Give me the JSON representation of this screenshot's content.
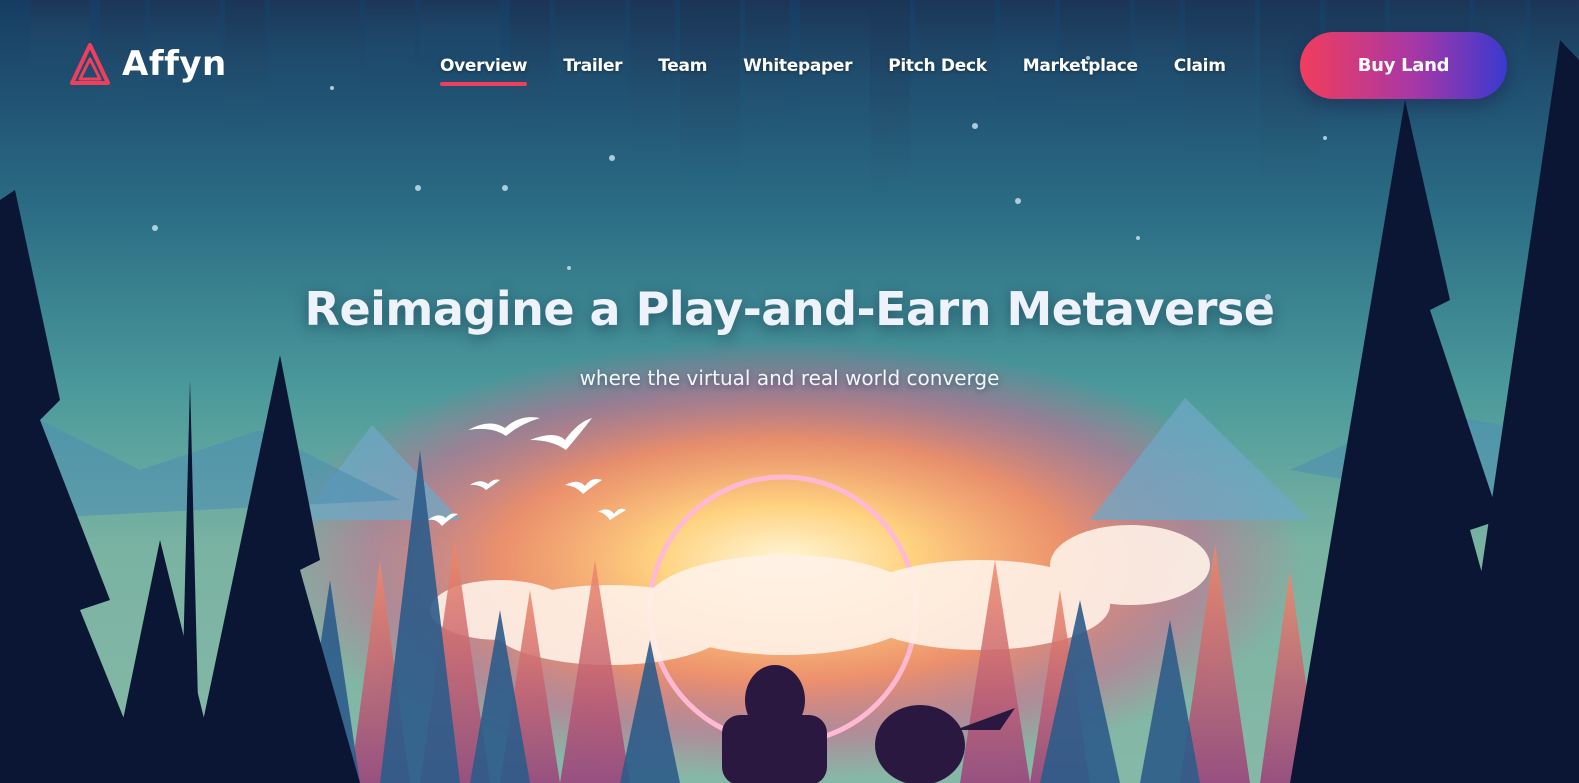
{
  "brand": {
    "name": "Affyn",
    "logo_icon": "affyn-logo-icon"
  },
  "nav": {
    "items": [
      {
        "label": "Overview",
        "active": true
      },
      {
        "label": "Trailer",
        "active": false
      },
      {
        "label": "Team",
        "active": false
      },
      {
        "label": "Whitepaper",
        "active": false
      },
      {
        "label": "Pitch Deck",
        "active": false
      },
      {
        "label": "Marketplace",
        "active": false
      },
      {
        "label": "Claim",
        "active": false
      }
    ],
    "cta_label": "Buy Land"
  },
  "hero": {
    "title": "Reimagine a Play-and-Earn Metaverse",
    "subtitle": "where the virtual and real world converge"
  },
  "colors": {
    "accent": "#ef3f5c",
    "cta_gradient_start": "#f23d5c",
    "cta_gradient_end": "#3a39cf",
    "sky_top": "#1c4f78",
    "sky_mid": "#3f8f9a",
    "sunset_glow": "#ff9a63",
    "tree_silhouette": "#0b1634"
  }
}
